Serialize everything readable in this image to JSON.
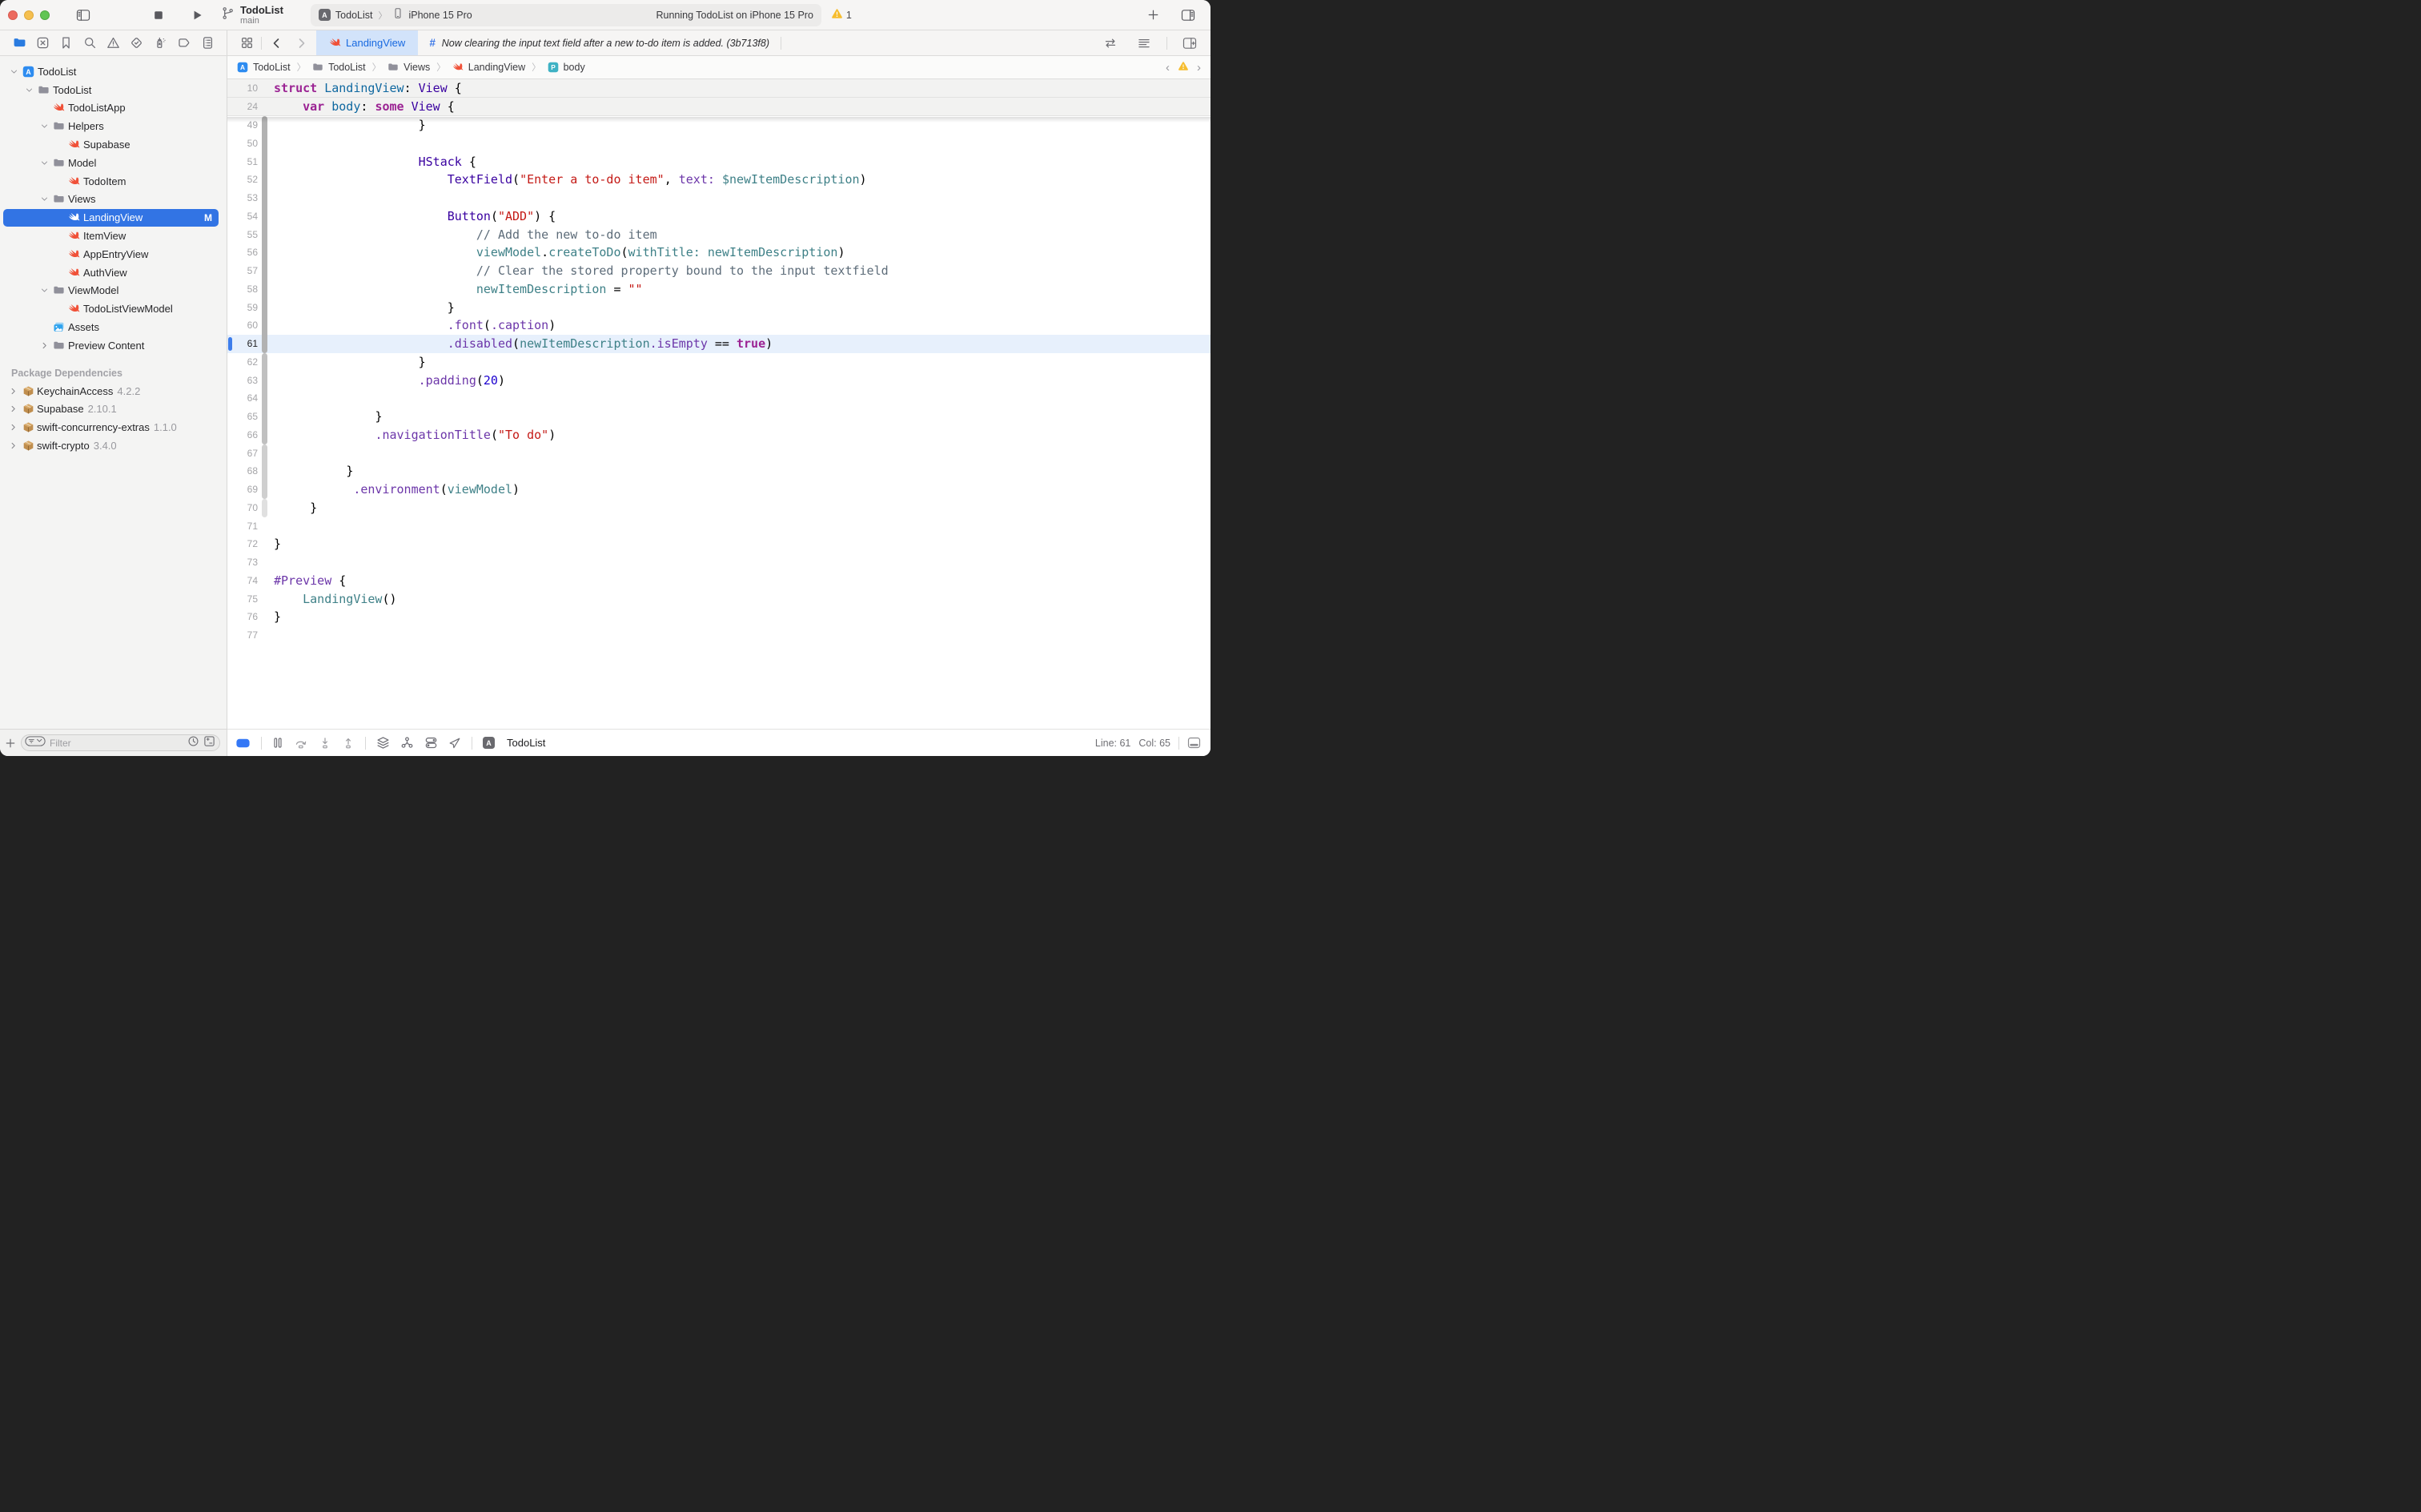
{
  "window": {
    "toolbar": {
      "title": "TodoList",
      "branch": "main",
      "scheme_app": "TodoList",
      "scheme_separator": "〉",
      "scheme_device": "iPhone 15 Pro",
      "status": "Running TodoList on iPhone 15 Pro",
      "warning_count": "1"
    }
  },
  "navigator_strip": {
    "icons": [
      "project-navigator",
      "source-control",
      "bookmarks",
      "find",
      "issues",
      "tests",
      "debug-gauge",
      "breakpoints",
      "reports"
    ],
    "selected": "project-navigator",
    "accent": "#2A7BE0"
  },
  "tabs": {
    "open_tab": {
      "label": "LandingView",
      "icon": "swift-file"
    },
    "commit_tab": {
      "prefix": "#",
      "label": "Now clearing the input text field after a new to-do item is added. (3b713f8)"
    }
  },
  "breadcrumb": {
    "items": [
      {
        "label": "TodoList",
        "icon": "app-badge"
      },
      {
        "label": "TodoList",
        "icon": "folder"
      },
      {
        "label": "Views",
        "icon": "folder"
      },
      {
        "label": "LandingView",
        "icon": "swift"
      },
      {
        "label": "body",
        "icon": "p-badge"
      }
    ]
  },
  "sidebar": {
    "items": [
      {
        "label": "TodoList",
        "icon": "app",
        "depth": 0,
        "disclosure": "open"
      },
      {
        "label": "TodoList",
        "icon": "folder",
        "depth": 1,
        "disclosure": "open"
      },
      {
        "label": "TodoListApp",
        "icon": "swift",
        "depth": 2
      },
      {
        "label": "Helpers",
        "icon": "folder",
        "depth": 2,
        "disclosure": "open"
      },
      {
        "label": "Supabase",
        "icon": "swift",
        "depth": 3
      },
      {
        "label": "Model",
        "icon": "folder",
        "depth": 2,
        "disclosure": "open"
      },
      {
        "label": "TodoItem",
        "icon": "swift",
        "depth": 3
      },
      {
        "label": "Views",
        "icon": "folder",
        "depth": 2,
        "disclosure": "open"
      },
      {
        "label": "LandingView",
        "icon": "swift",
        "depth": 3,
        "selected": true,
        "badge": "M"
      },
      {
        "label": "ItemView",
        "icon": "swift",
        "depth": 3
      },
      {
        "label": "AppEntryView",
        "icon": "swift",
        "depth": 3
      },
      {
        "label": "AuthView",
        "icon": "swift",
        "depth": 3
      },
      {
        "label": "ViewModel",
        "icon": "folder",
        "depth": 2,
        "disclosure": "open"
      },
      {
        "label": "TodoListViewModel",
        "icon": "swift",
        "depth": 3
      },
      {
        "label": "Assets",
        "icon": "assets",
        "depth": 2
      },
      {
        "label": "Preview Content",
        "icon": "folder",
        "depth": 2,
        "disclosure": "closed"
      }
    ],
    "packages_header": "Package Dependencies",
    "packages": [
      {
        "name": "KeychainAccess",
        "version": "4.2.2"
      },
      {
        "name": "Supabase",
        "version": "2.10.1"
      },
      {
        "name": "swift-concurrency-extras",
        "version": "1.1.0"
      },
      {
        "name": "swift-crypto",
        "version": "3.4.0"
      }
    ],
    "selection_color": "#3274E4",
    "swift_icon_color": "#F05138"
  },
  "sidebar_footer": {
    "filter_placeholder": "Filter"
  },
  "editor": {
    "colors": {
      "k": "#9B2393",
      "t": "#3900A0",
      "d": "#0F68A0",
      "v": "#3E8087",
      "m": "#6C36A9",
      "s": "#C41A16",
      "n": "#1C00CF",
      "c": "#5D6C79",
      "x": "#000000"
    },
    "selected_line": 61,
    "sticky_lines": [
      {
        "n": 10,
        "ind": 0,
        "toks": [
          [
            "k",
            "struct"
          ],
          [
            "x",
            " "
          ],
          [
            "d",
            "LandingView"
          ],
          [
            "x",
            ": "
          ],
          [
            "t",
            "View"
          ],
          [
            "x",
            " {"
          ]
        ]
      },
      {
        "n": 24,
        "ind": 4,
        "toks": [
          [
            "k",
            "var"
          ],
          [
            "x",
            " "
          ],
          [
            "d",
            "body"
          ],
          [
            "x",
            ": "
          ],
          [
            "k",
            "some"
          ],
          [
            "x",
            " "
          ],
          [
            "t",
            "View"
          ],
          [
            "x",
            " {"
          ]
        ]
      }
    ],
    "lines": [
      {
        "n": 49,
        "ind": 20,
        "toks": [
          [
            "x",
            "}"
          ]
        ]
      },
      {
        "n": 50,
        "ind": 0,
        "toks": []
      },
      {
        "n": 51,
        "ind": 20,
        "toks": [
          [
            "t",
            "HStack"
          ],
          [
            "x",
            " {"
          ]
        ]
      },
      {
        "n": 52,
        "ind": 24,
        "toks": [
          [
            "t",
            "TextField"
          ],
          [
            "x",
            "("
          ],
          [
            "s",
            "\"Enter a to-do item\""
          ],
          [
            "x",
            ", "
          ],
          [
            "m",
            "text:"
          ],
          [
            "x",
            " "
          ],
          [
            "v",
            "$newItemDescription"
          ],
          [
            "x",
            ")"
          ]
        ]
      },
      {
        "n": 53,
        "ind": 0,
        "toks": []
      },
      {
        "n": 54,
        "ind": 24,
        "toks": [
          [
            "t",
            "Button"
          ],
          [
            "x",
            "("
          ],
          [
            "s",
            "\"ADD\""
          ],
          [
            "x",
            ") {"
          ]
        ]
      },
      {
        "n": 55,
        "ind": 28,
        "toks": [
          [
            "c",
            "// Add the new to-do item"
          ]
        ]
      },
      {
        "n": 56,
        "ind": 28,
        "toks": [
          [
            "v",
            "viewModel"
          ],
          [
            "x",
            "."
          ],
          [
            "v",
            "createToDo"
          ],
          [
            "x",
            "("
          ],
          [
            "v",
            "withTitle:"
          ],
          [
            "x",
            " "
          ],
          [
            "v",
            "newItemDescription"
          ],
          [
            "x",
            ")"
          ]
        ]
      },
      {
        "n": 57,
        "ind": 28,
        "toks": [
          [
            "c",
            "// Clear the stored property bound to the input textfield"
          ]
        ]
      },
      {
        "n": 58,
        "ind": 28,
        "toks": [
          [
            "v",
            "newItemDescription"
          ],
          [
            "x",
            " = "
          ],
          [
            "s",
            "\"\""
          ]
        ]
      },
      {
        "n": 59,
        "ind": 24,
        "toks": [
          [
            "x",
            "}"
          ]
        ]
      },
      {
        "n": 60,
        "ind": 24,
        "toks": [
          [
            "m",
            ".font"
          ],
          [
            "x",
            "("
          ],
          [
            "m",
            ".caption"
          ],
          [
            "x",
            ")"
          ]
        ]
      },
      {
        "n": 61,
        "ind": 24,
        "sel": true,
        "toks": [
          [
            "m",
            ".disabled"
          ],
          [
            "x",
            "("
          ],
          [
            "v",
            "newItemDescription"
          ],
          [
            "m",
            ".isEmpty"
          ],
          [
            "x",
            " == "
          ],
          [
            "k",
            "true"
          ],
          [
            "x",
            ")"
          ]
        ]
      },
      {
        "n": 62,
        "ind": 20,
        "toks": [
          [
            "x",
            "}"
          ]
        ]
      },
      {
        "n": 63,
        "ind": 20,
        "toks": [
          [
            "m",
            ".padding"
          ],
          [
            "x",
            "("
          ],
          [
            "n",
            "20"
          ],
          [
            "x",
            ")"
          ]
        ]
      },
      {
        "n": 64,
        "ind": 0,
        "toks": []
      },
      {
        "n": 65,
        "ind": 14,
        "toks": [
          [
            "x",
            "}"
          ]
        ]
      },
      {
        "n": 66,
        "ind": 14,
        "toks": [
          [
            "m",
            ".navigationTitle"
          ],
          [
            "x",
            "("
          ],
          [
            "s",
            "\"To do\""
          ],
          [
            "x",
            ")"
          ]
        ]
      },
      {
        "n": 67,
        "ind": 0,
        "toks": []
      },
      {
        "n": 68,
        "ind": 10,
        "toks": [
          [
            "x",
            "}"
          ]
        ]
      },
      {
        "n": 69,
        "ind": 11,
        "toks": [
          [
            "m",
            ".environment"
          ],
          [
            "x",
            "("
          ],
          [
            "v",
            "viewModel"
          ],
          [
            "x",
            ")"
          ]
        ]
      },
      {
        "n": 70,
        "ind": 5,
        "toks": [
          [
            "x",
            "}"
          ]
        ]
      },
      {
        "n": 71,
        "ind": 0,
        "toks": []
      },
      {
        "n": 72,
        "ind": 0,
        "toks": [
          [
            "x",
            "}"
          ]
        ]
      },
      {
        "n": 73,
        "ind": 0,
        "toks": []
      },
      {
        "n": 74,
        "ind": 0,
        "toks": [
          [
            "m",
            "#Preview"
          ],
          [
            "x",
            " {"
          ]
        ]
      },
      {
        "n": 75,
        "ind": 4,
        "toks": [
          [
            "v",
            "LandingView"
          ],
          [
            "x",
            "()"
          ]
        ]
      },
      {
        "n": 76,
        "ind": 0,
        "toks": [
          [
            "x",
            "}"
          ]
        ]
      },
      {
        "n": 77,
        "ind": 0,
        "toks": []
      }
    ],
    "change_bars": [
      {
        "from": 49,
        "to": 61,
        "color": "#B2B2B2"
      },
      {
        "from": 62,
        "to": 66,
        "color": "#C0C0C0"
      },
      {
        "from": 67,
        "to": 69,
        "color": "#CFCFCF"
      },
      {
        "from": 70,
        "to": 70,
        "color": "#E0E0E0"
      }
    ]
  },
  "debug_bar": {
    "icons": [
      "breakpoints-toggle",
      "pause",
      "step-over",
      "step-into",
      "step-out",
      "view-hierarchy",
      "memory-graph",
      "environment-overrides",
      "location"
    ],
    "breakpoint_color": "#3478F6",
    "app_label": "TodoList"
  },
  "status_bar": {
    "line": "Line: 61",
    "col": "Col: 65"
  }
}
